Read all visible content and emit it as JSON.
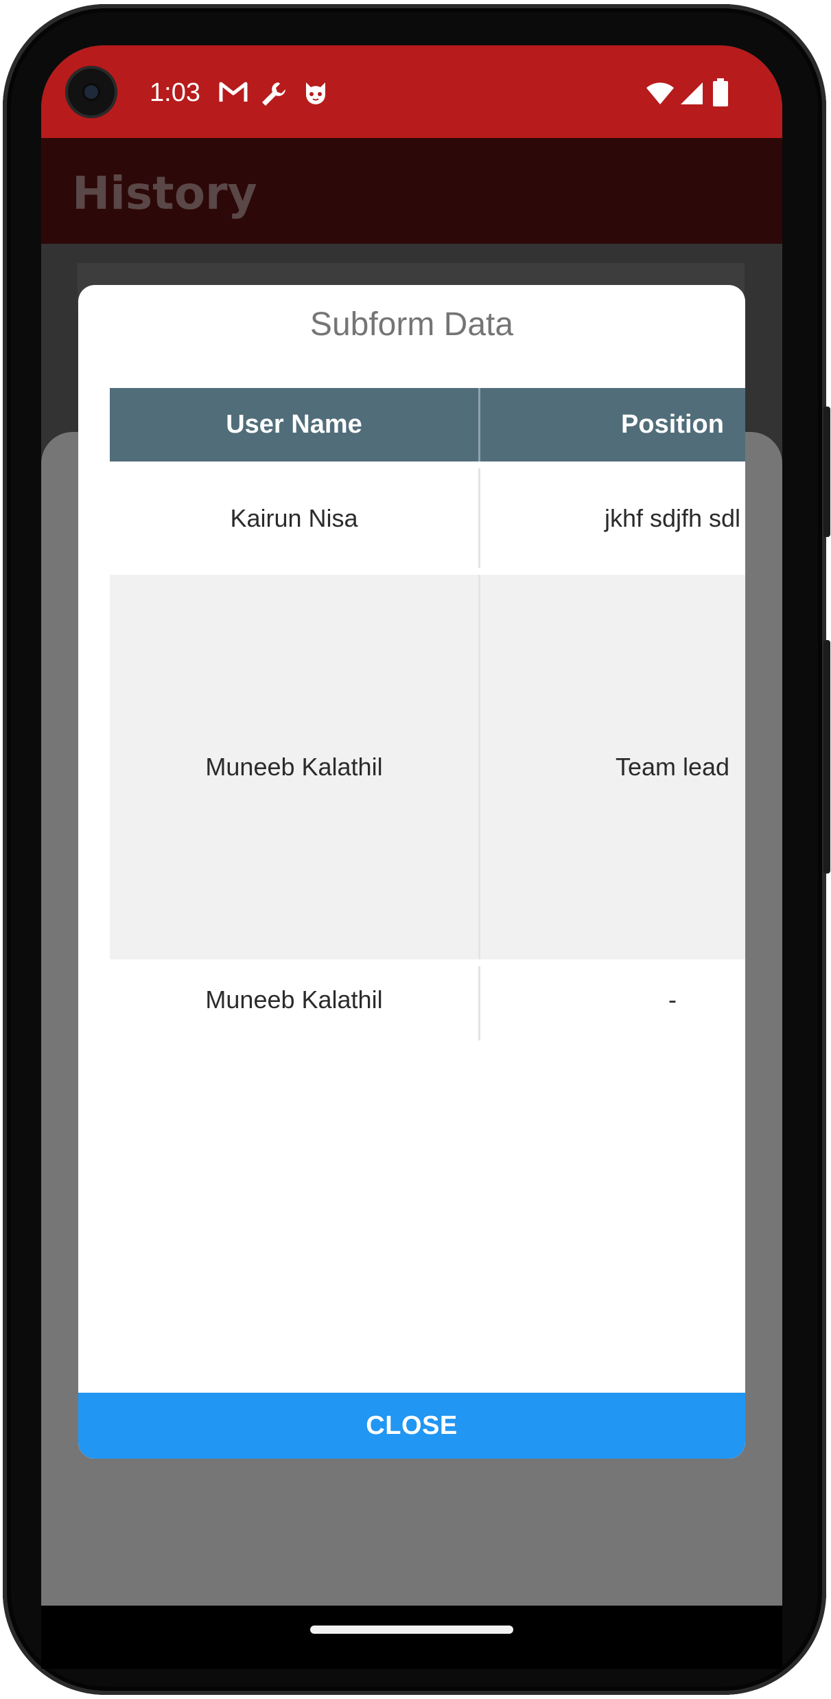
{
  "statusbar": {
    "time": "1:03",
    "notification_icons": [
      "gmail-icon",
      "wrench-icon",
      "cat-face-icon"
    ],
    "system_icons": [
      "wifi-icon",
      "cell-signal-icon",
      "battery-icon"
    ]
  },
  "appbar": {
    "title": "History"
  },
  "dialog": {
    "title": "Subform Data",
    "table": {
      "columns": [
        "User Name",
        "Position"
      ],
      "rows": [
        {
          "user_name": "Kairun Nisa",
          "position": "jkhf sdjfh sdl"
        },
        {
          "user_name": "Muneeb Kalathil",
          "position": "Team lead"
        },
        {
          "user_name": "Muneeb Kalathil",
          "position": "-"
        }
      ]
    },
    "close_label": "CLOSE"
  },
  "colors": {
    "statusbar": "#b71b1b",
    "table_header": "#516d7a",
    "close_button": "#2196f3"
  }
}
